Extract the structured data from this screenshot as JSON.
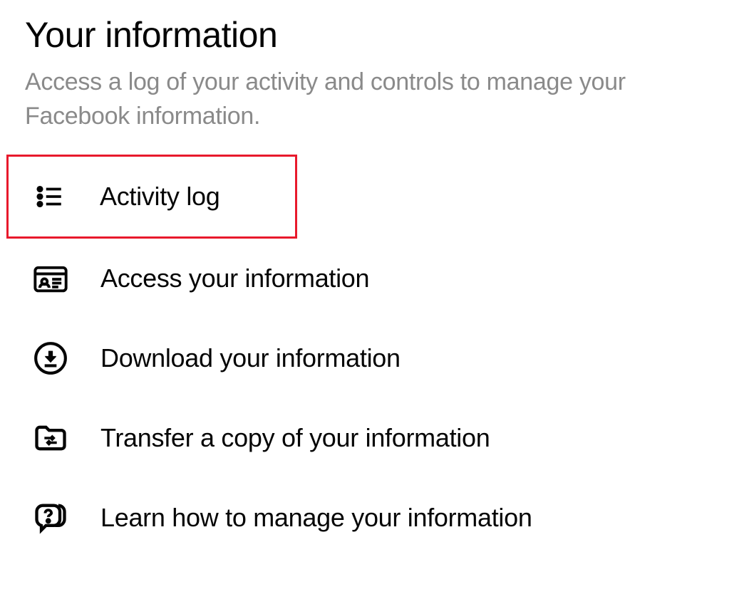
{
  "header": {
    "title": "Your information",
    "subtitle": "Access a log of your activity and controls to manage your Facebook information."
  },
  "menu": {
    "items": [
      {
        "label": "Activity log",
        "icon": "list-icon",
        "highlighted": true
      },
      {
        "label": "Access your information",
        "icon": "id-card-icon",
        "highlighted": false
      },
      {
        "label": "Download your information",
        "icon": "download-icon",
        "highlighted": false
      },
      {
        "label": "Transfer a copy of your information",
        "icon": "folder-transfer-icon",
        "highlighted": false
      },
      {
        "label": "Learn how to manage your information",
        "icon": "question-chat-icon",
        "highlighted": false
      }
    ]
  }
}
